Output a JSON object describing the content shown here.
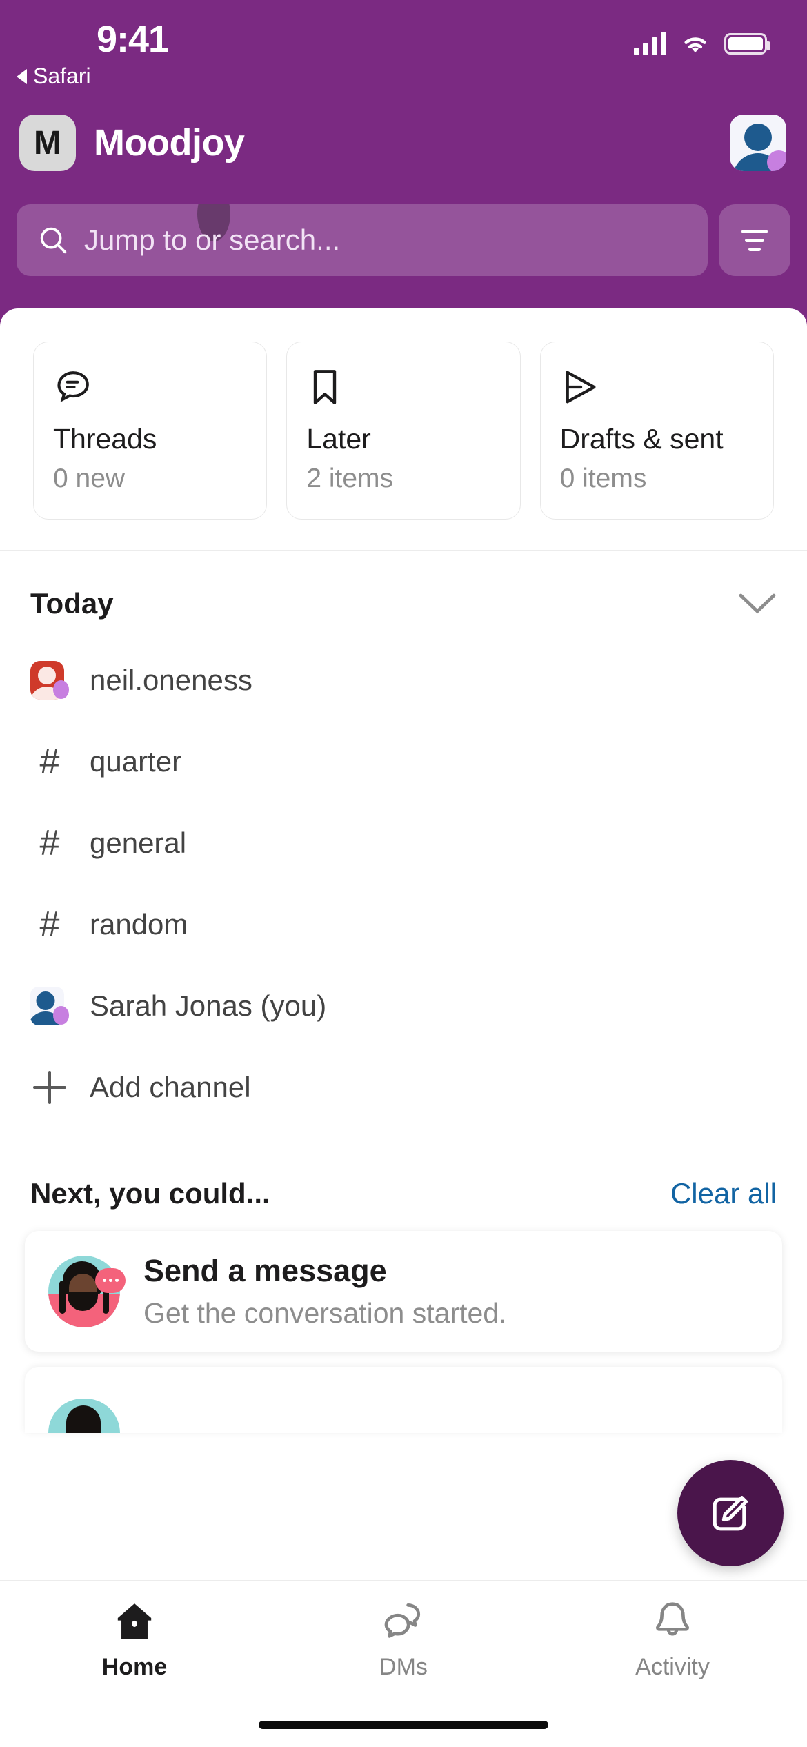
{
  "status_bar": {
    "time": "9:41",
    "back_label": "Safari",
    "icons": [
      "cellular-signal-icon",
      "wifi-icon",
      "battery-icon"
    ]
  },
  "header": {
    "workspace_initial": "M",
    "workspace_name": "Moodjoy",
    "avatar_name": "user-avatar",
    "presence": "away"
  },
  "search": {
    "placeholder": "Jump to or search...",
    "search_icon": "search-icon",
    "filter_icon": "filter-icon"
  },
  "quick_cards": [
    {
      "icon": "threads-icon",
      "title": "Threads",
      "subtitle": "0 new"
    },
    {
      "icon": "bookmark-icon",
      "title": "Later",
      "subtitle": "2 items"
    },
    {
      "icon": "send-icon",
      "title": "Drafts & sent",
      "subtitle": "0 items"
    }
  ],
  "today": {
    "title": "Today",
    "collapse_icon": "chevron-down-icon",
    "items": [
      {
        "type": "dm",
        "icon": "avatar-neil",
        "label": "neil.oneness"
      },
      {
        "type": "channel",
        "icon": "hash-icon",
        "label": "quarter"
      },
      {
        "type": "channel",
        "icon": "hash-icon",
        "label": "general"
      },
      {
        "type": "channel",
        "icon": "hash-icon",
        "label": "random"
      },
      {
        "type": "dm",
        "icon": "avatar-sarah",
        "label": "Sarah Jonas (you)"
      },
      {
        "type": "action",
        "icon": "plus-icon",
        "label": "Add channel"
      }
    ]
  },
  "suggestions": {
    "title": "Next, you could...",
    "clear_label": "Clear all",
    "cards": [
      {
        "illustration": "person-with-chat-bubble-illustration",
        "title": "Send a message",
        "subtitle": "Get the conversation started."
      }
    ]
  },
  "fab": {
    "icon": "compose-icon",
    "color": "#4A154B"
  },
  "tabs": [
    {
      "icon": "home-icon",
      "label": "Home",
      "active": true
    },
    {
      "icon": "dms-icon",
      "label": "DMs",
      "active": false
    },
    {
      "icon": "activity-icon",
      "label": "Activity",
      "active": false
    }
  ],
  "colors": {
    "header_purple": "#7B2A82",
    "fab_purple": "#4A154B",
    "link_blue": "#1264A3",
    "presence_purple": "#C77FE0"
  }
}
